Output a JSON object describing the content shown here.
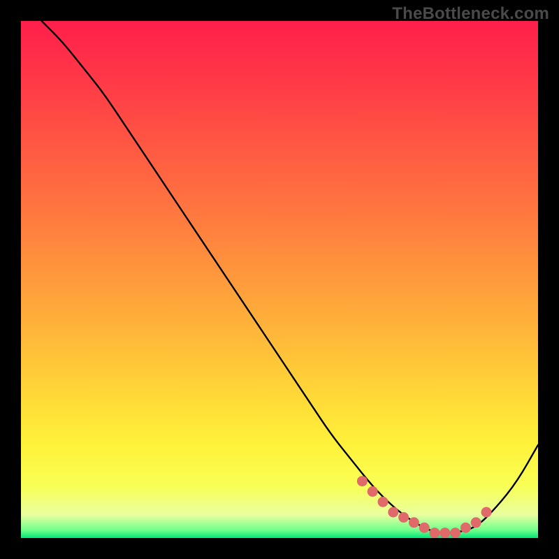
{
  "watermark": "TheBottleneck.com",
  "colors": {
    "bg": "#000000",
    "gradient_stops": [
      {
        "offset": 0.0,
        "color": "#ff1f4b"
      },
      {
        "offset": 0.12,
        "color": "#ff3a47"
      },
      {
        "offset": 0.25,
        "color": "#ff5a42"
      },
      {
        "offset": 0.38,
        "color": "#ff7a3f"
      },
      {
        "offset": 0.5,
        "color": "#ff9a3c"
      },
      {
        "offset": 0.62,
        "color": "#ffbb39"
      },
      {
        "offset": 0.73,
        "color": "#ffda37"
      },
      {
        "offset": 0.82,
        "color": "#fff23a"
      },
      {
        "offset": 0.9,
        "color": "#f8ff55"
      },
      {
        "offset": 0.955,
        "color": "#e9ffa0"
      },
      {
        "offset": 0.985,
        "color": "#6fff8c"
      },
      {
        "offset": 1.0,
        "color": "#00e676"
      }
    ],
    "curve": "#000000",
    "marker_fill": "#e06a6a",
    "marker_stroke": "#be4a4a"
  },
  "chart_data": {
    "type": "line",
    "title": "",
    "xlabel": "",
    "ylabel": "",
    "xlim": [
      0,
      100
    ],
    "ylim": [
      0,
      100
    ],
    "grid": false,
    "series": [
      {
        "name": "bottleneck-curve",
        "x": [
          4,
          8,
          12,
          16,
          20,
          24,
          28,
          32,
          36,
          40,
          44,
          48,
          52,
          56,
          60,
          64,
          68,
          72,
          76,
          80,
          84,
          88,
          92,
          96,
          100
        ],
        "values": [
          100,
          96,
          91,
          86,
          80,
          74,
          68,
          62,
          56,
          50,
          44,
          38,
          32,
          26,
          20,
          15,
          10,
          6,
          3,
          1,
          1,
          2,
          6,
          11,
          18
        ]
      }
    ],
    "markers": {
      "name": "highlight-range",
      "x": [
        66,
        68,
        70,
        72,
        74,
        76,
        78,
        80,
        82,
        84,
        86,
        88,
        90
      ],
      "values": [
        11,
        9,
        7,
        5,
        4,
        3,
        2,
        1,
        1,
        1,
        2,
        3,
        5
      ]
    }
  }
}
